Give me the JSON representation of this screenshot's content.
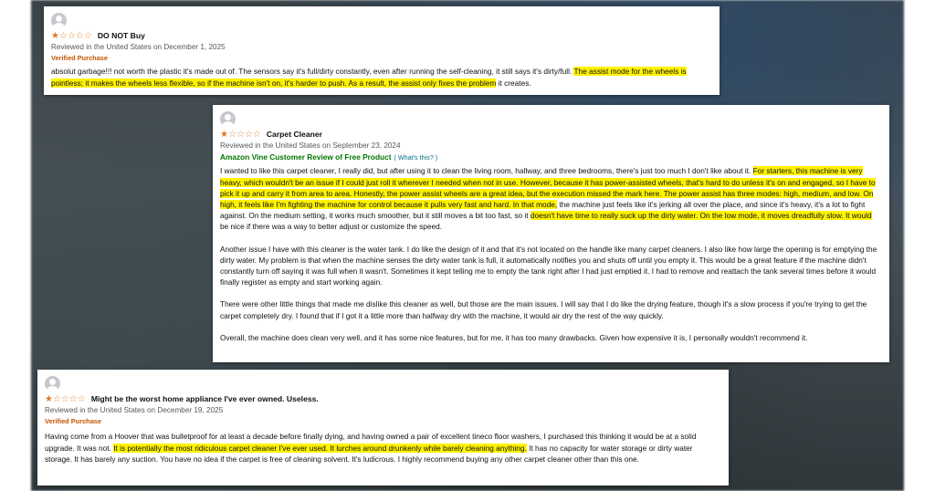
{
  "colors": {
    "star": "#de7921",
    "highlight": "#fff200",
    "verified": "#c45500",
    "vine": "#007600",
    "link": "#007185"
  },
  "reviews": [
    {
      "stars_filled": 1,
      "stars_total": 5,
      "title": "DO NOT Buy",
      "meta": "Reviewed in the United States on December 1, 2025",
      "badge": "Verified Purchase",
      "paragraphs": [
        [
          {
            "text": "absolut garbage!!! not worth the plastic it's made out of. The sensors say it's full/dirty constantly, even after running the self-cleaning, it still says it's dirty/full. ",
            "hl": false
          },
          {
            "text": "The assist mode for the wheels is pointless; it makes the wheels less flexible, so if the machine isn't on, it's harder to push. As a result, the assist only fixes the problem",
            "hl": true
          },
          {
            "text": " it creates.",
            "hl": false
          }
        ]
      ]
    },
    {
      "stars_filled": 1,
      "stars_total": 5,
      "title": "Carpet Cleaner",
      "meta": "Reviewed in the United States on September 23, 2024",
      "vine": "Amazon Vine Customer Review of Free Product",
      "vine_link": "( What's this? )",
      "paragraphs": [
        [
          {
            "text": "I wanted to like this carpet cleaner, I really did, but after using it to clean the living room, hallway, and three bedrooms, there's just too much I don't like about it. ",
            "hl": false
          },
          {
            "text": "For starters, this machine is very heavy, which wouldn't be an issue if I could just roll it wherever I needed when not in use. However, because it has power-assisted wheels, that's hard to do unless it's on and engaged, so I have to pick it up and carry it from area to area. Honestly, the power assist wheels are a great idea, but the execution missed the mark here. The power assist has three modes: high, medium, and low. On high, it feels like I'm fighting the machine for control because it pulls very fast and hard. In that mode,",
            "hl": true
          },
          {
            "text": " the machine just feels like it's jerking all over the place, and since it's heavy, it's a lot to fight against. On the medium setting, it works much smoother, but it still moves a bit too fast, so it ",
            "hl": false
          },
          {
            "text": "doesn't have time to really suck up the dirty water. On the low mode, it moves dreadfully slow. It would",
            "hl": true
          },
          {
            "text": " be nice if there was a way to better adjust or customize the speed.",
            "hl": false
          }
        ],
        [
          {
            "text": "Another issue I have with this cleaner is the water tank. I do like the design of it and that it's not located on the handle like many carpet cleaners. I also like how large the opening is for emptying the dirty water. My problem is that when the machine senses the dirty water tank is full, it automatically notifies you and shuts off until you empty it. This would be a great feature if the machine didn't constantly turn off saying it was full when it wasn't. Sometimes it kept telling me to empty the tank right after I had just emptied it. I had to remove and reattach the tank several times before it would finally register as empty and start working again.",
            "hl": false
          }
        ],
        [
          {
            "text": "There were other little things that made me dislike this cleaner as well, but those are the main issues. I will say that I do like the drying feature, though it's a slow process if you're trying to get the carpet completely dry. I found that if I got it a little more than halfway dry with the machine, it would air dry the rest of the way quickly.",
            "hl": false
          }
        ],
        [
          {
            "text": "Overall, the machine does clean very well, and it has some nice features, but for me, it has too many drawbacks. Given how expensive it is, I personally wouldn't recommend it.",
            "hl": false
          }
        ]
      ]
    },
    {
      "stars_filled": 1,
      "stars_total": 5,
      "title": "Might be the worst home appliance I've ever owned. Useless.",
      "meta": "Reviewed in the United States on December 19, 2025",
      "badge": "Verified Purchase",
      "paragraphs": [
        [
          {
            "text": "Having come from a Hoover that was bulletproof for at least a decade before finally dying, and having owned a pair of excellent tineco floor washers, I purchased this thinking it would be at a solid upgrade. It was not. ",
            "hl": false
          },
          {
            "text": "It is potentially the most ridiculous carpet cleaner I've ever used. It lurches around drunkenly while barely cleaning anything.",
            "hl": true
          },
          {
            "text": " It has no capacity for water storage or dirty water storage. It has barely any suction. You have no idea if the carpet is free of cleaning solvent. It's ludicrous. I highly recommend buying any other carpet cleaner other than this one.",
            "hl": false
          }
        ]
      ]
    }
  ]
}
